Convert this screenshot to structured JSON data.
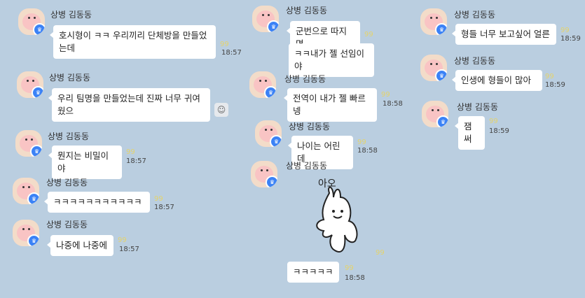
{
  "user": "상병 김동동",
  "count_label": "99",
  "columns": [
    {
      "messages": [
        {
          "text": "호시형이 ㅋㅋ 우리끼리 단체방을 만들었는데",
          "time": "18:57"
        },
        {
          "text": "우리 팀명을 만들었는데 진짜 너무 귀여웠으",
          "time": ""
        },
        {
          "text": "뭔지는 비밀이야",
          "time": "18:57"
        },
        {
          "text": "ㅋㅋㅋㅋㅋㅋㅋㅋㅋㅋㅋ",
          "time": "18:57"
        },
        {
          "text": "나중에 나중에",
          "time": "18:57"
        }
      ]
    },
    {
      "messages": [
        {
          "text": "군번으로 따지면",
          "time": ""
        },
        {
          "text": "ㅋㅋ내가 젤 선임이야",
          "time": ""
        },
        {
          "text": "전역이 내가 젤 빠르넹",
          "time": "18:58"
        },
        {
          "text": "나이는 어린데",
          "time": "18:58"
        },
        {
          "text": "ㅋㅋㅋㅋㅋ",
          "time": "18:58"
        }
      ],
      "sticker_caption": "아오"
    },
    {
      "messages": [
        {
          "text": "형들 너무 보고싶어 얼른",
          "time": "18:59"
        },
        {
          "text": "인생에 형들이 많아",
          "time": "18:59"
        },
        {
          "text": "잼써",
          "time": "18:59"
        }
      ]
    }
  ],
  "emoji_button": "☺"
}
